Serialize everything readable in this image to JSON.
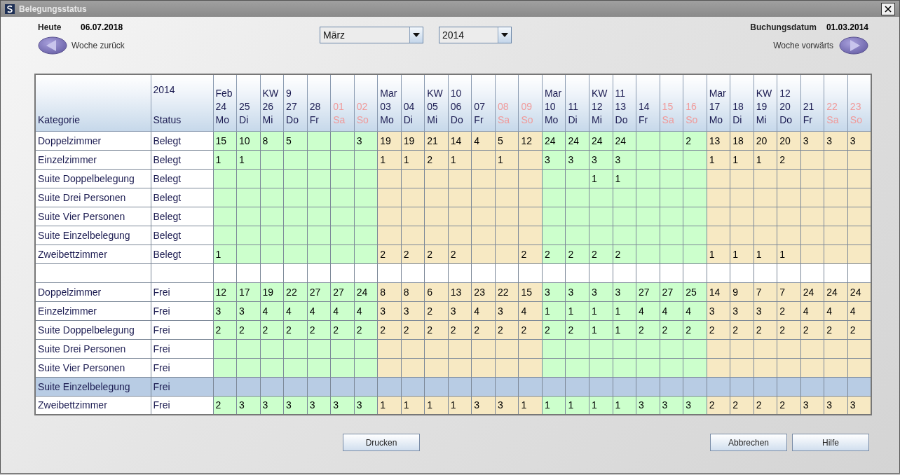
{
  "window": {
    "title": "Belegungsstatus"
  },
  "today": {
    "label": "Heute",
    "value": "06.07.2018"
  },
  "week_back": {
    "label": "Woche zurück"
  },
  "month_select": {
    "value": "März"
  },
  "year_select": {
    "value": "2014"
  },
  "booking_date": {
    "label": "Buchungsdatum",
    "value": "01.03.2014"
  },
  "week_forward": {
    "label": "Woche vorwärts"
  },
  "table": {
    "category_header": "Kategorie",
    "status_header": [
      "2014",
      "Status"
    ],
    "columns": [
      {
        "lines": [
          "Feb",
          "24",
          "Mo"
        ],
        "weekend": false,
        "color": "#ccffcc"
      },
      {
        "lines": [
          "25",
          "Di"
        ],
        "weekend": false,
        "color": "#ccffcc"
      },
      {
        "lines": [
          "KW",
          "26",
          "Mi"
        ],
        "weekend": false,
        "color": "#ccffcc"
      },
      {
        "lines": [
          "9",
          "27",
          "Do"
        ],
        "weekend": false,
        "color": "#ccffcc"
      },
      {
        "lines": [
          "28",
          "Fr"
        ],
        "weekend": false,
        "color": "#ccffcc"
      },
      {
        "lines": [
          "01",
          "Sa"
        ],
        "weekend": true,
        "color": "#ccffcc"
      },
      {
        "lines": [
          "02",
          "So"
        ],
        "weekend": true,
        "color": "#ccffcc"
      },
      {
        "lines": [
          "Mar",
          "03",
          "Mo"
        ],
        "weekend": false,
        "color": "#f7e9c3"
      },
      {
        "lines": [
          "04",
          "Di"
        ],
        "weekend": false,
        "color": "#f7e9c3"
      },
      {
        "lines": [
          "KW",
          "05",
          "Mi"
        ],
        "weekend": false,
        "color": "#f7e9c3"
      },
      {
        "lines": [
          "10",
          "06",
          "Do"
        ],
        "weekend": false,
        "color": "#f7e9c3"
      },
      {
        "lines": [
          "07",
          "Fr"
        ],
        "weekend": false,
        "color": "#f7e9c3"
      },
      {
        "lines": [
          "08",
          "Sa"
        ],
        "weekend": true,
        "color": "#f7e9c3"
      },
      {
        "lines": [
          "09",
          "So"
        ],
        "weekend": true,
        "color": "#f7e9c3"
      },
      {
        "lines": [
          "Mar",
          "10",
          "Mo"
        ],
        "weekend": false,
        "color": "#ccffcc"
      },
      {
        "lines": [
          "11",
          "Di"
        ],
        "weekend": false,
        "color": "#ccffcc"
      },
      {
        "lines": [
          "KW",
          "12",
          "Mi"
        ],
        "weekend": false,
        "color": "#ccffcc"
      },
      {
        "lines": [
          "11",
          "13",
          "Do"
        ],
        "weekend": false,
        "color": "#ccffcc"
      },
      {
        "lines": [
          "14",
          "Fr"
        ],
        "weekend": false,
        "color": "#ccffcc"
      },
      {
        "lines": [
          "15",
          "Sa"
        ],
        "weekend": true,
        "color": "#ccffcc"
      },
      {
        "lines": [
          "16",
          "So"
        ],
        "weekend": true,
        "color": "#ccffcc"
      },
      {
        "lines": [
          "Mar",
          "17",
          "Mo"
        ],
        "weekend": false,
        "color": "#f7e9c3"
      },
      {
        "lines": [
          "18",
          "Di"
        ],
        "weekend": false,
        "color": "#f7e9c3"
      },
      {
        "lines": [
          "KW",
          "19",
          "Mi"
        ],
        "weekend": false,
        "color": "#f7e9c3"
      },
      {
        "lines": [
          "12",
          "20",
          "Do"
        ],
        "weekend": false,
        "color": "#f7e9c3"
      },
      {
        "lines": [
          "21",
          "Fr"
        ],
        "weekend": false,
        "color": "#f7e9c3"
      },
      {
        "lines": [
          "22",
          "Sa"
        ],
        "weekend": true,
        "color": "#f7e9c3"
      },
      {
        "lines": [
          "23",
          "So"
        ],
        "weekend": true,
        "color": "#f7e9c3"
      }
    ],
    "rows": [
      {
        "kind": "data",
        "selected": false,
        "category": "Doppelzimmer",
        "status": "Belegt",
        "cells": [
          {
            "kind": "number",
            "value": "15"
          },
          {
            "kind": "number",
            "value": "10"
          },
          {
            "kind": "number",
            "value": "8"
          },
          {
            "kind": "number",
            "value": "5"
          },
          {
            "kind": "blank"
          },
          {
            "kind": "blank"
          },
          {
            "kind": "number",
            "value": "3"
          },
          {
            "kind": "number",
            "value": "19"
          },
          {
            "kind": "number",
            "value": "19"
          },
          {
            "kind": "number",
            "value": "21"
          },
          {
            "kind": "number",
            "value": "14"
          },
          {
            "kind": "number",
            "value": "4"
          },
          {
            "kind": "number",
            "value": "5"
          },
          {
            "kind": "number",
            "value": "12"
          },
          {
            "kind": "number",
            "value": "24"
          },
          {
            "kind": "number",
            "value": "24"
          },
          {
            "kind": "number",
            "value": "24"
          },
          {
            "kind": "number",
            "value": "24"
          },
          {
            "kind": "blank"
          },
          {
            "kind": "blank"
          },
          {
            "kind": "number",
            "value": "2"
          },
          {
            "kind": "number",
            "value": "13"
          },
          {
            "kind": "number",
            "value": "18"
          },
          {
            "kind": "number",
            "value": "20"
          },
          {
            "kind": "number",
            "value": "20"
          },
          {
            "kind": "number",
            "value": "3"
          },
          {
            "kind": "number",
            "value": "3"
          },
          {
            "kind": "number",
            "value": "3"
          }
        ]
      },
      {
        "kind": "data",
        "selected": false,
        "category": "Einzelzimmer",
        "status": "Belegt",
        "cells": [
          {
            "kind": "number",
            "value": "1"
          },
          {
            "kind": "number",
            "value": "1"
          },
          {
            "kind": "blank"
          },
          {
            "kind": "blank"
          },
          {
            "kind": "blank"
          },
          {
            "kind": "blank"
          },
          {
            "kind": "blank"
          },
          {
            "kind": "number",
            "value": "1"
          },
          {
            "kind": "number",
            "value": "1"
          },
          {
            "kind": "number",
            "value": "2"
          },
          {
            "kind": "number",
            "value": "1"
          },
          {
            "kind": "blank"
          },
          {
            "kind": "number",
            "value": "1"
          },
          {
            "kind": "blank"
          },
          {
            "kind": "number",
            "value": "3"
          },
          {
            "kind": "number",
            "value": "3"
          },
          {
            "kind": "number",
            "value": "3"
          },
          {
            "kind": "number",
            "value": "3"
          },
          {
            "kind": "blank"
          },
          {
            "kind": "blank"
          },
          {
            "kind": "blank"
          },
          {
            "kind": "number",
            "value": "1"
          },
          {
            "kind": "number",
            "value": "1"
          },
          {
            "kind": "number",
            "value": "1"
          },
          {
            "kind": "number",
            "value": "2"
          },
          {
            "kind": "blank"
          },
          {
            "kind": "blank"
          },
          {
            "kind": "blank"
          }
        ]
      },
      {
        "kind": "data",
        "selected": false,
        "category": "Suite Doppelbelegung",
        "status": "Belegt",
        "cells": [
          {
            "kind": "blank"
          },
          {
            "kind": "blank"
          },
          {
            "kind": "blank"
          },
          {
            "kind": "blank"
          },
          {
            "kind": "blank"
          },
          {
            "kind": "blank"
          },
          {
            "kind": "blank"
          },
          {
            "kind": "blank"
          },
          {
            "kind": "blank"
          },
          {
            "kind": "blank"
          },
          {
            "kind": "blank"
          },
          {
            "kind": "blank"
          },
          {
            "kind": "blank"
          },
          {
            "kind": "blank"
          },
          {
            "kind": "blank"
          },
          {
            "kind": "blank"
          },
          {
            "kind": "number",
            "value": "1"
          },
          {
            "kind": "number",
            "value": "1"
          },
          {
            "kind": "blank"
          },
          {
            "kind": "blank"
          },
          {
            "kind": "blank"
          },
          {
            "kind": "blank"
          },
          {
            "kind": "blank"
          },
          {
            "kind": "blank"
          },
          {
            "kind": "blank"
          },
          {
            "kind": "blank"
          },
          {
            "kind": "blank"
          },
          {
            "kind": "blank"
          }
        ]
      },
      {
        "kind": "data",
        "selected": false,
        "category": "Suite Drei Personen",
        "status": "Belegt",
        "cells": [
          {
            "kind": "blank"
          },
          {
            "kind": "blank"
          },
          {
            "kind": "blank"
          },
          {
            "kind": "blank"
          },
          {
            "kind": "blank"
          },
          {
            "kind": "blank"
          },
          {
            "kind": "blank"
          },
          {
            "kind": "blank"
          },
          {
            "kind": "blank"
          },
          {
            "kind": "blank"
          },
          {
            "kind": "blank"
          },
          {
            "kind": "blank"
          },
          {
            "kind": "blank"
          },
          {
            "kind": "blank"
          },
          {
            "kind": "blank"
          },
          {
            "kind": "blank"
          },
          {
            "kind": "blank"
          },
          {
            "kind": "blank"
          },
          {
            "kind": "blank"
          },
          {
            "kind": "blank"
          },
          {
            "kind": "blank"
          },
          {
            "kind": "blank"
          },
          {
            "kind": "blank"
          },
          {
            "kind": "blank"
          },
          {
            "kind": "blank"
          },
          {
            "kind": "blank"
          },
          {
            "kind": "blank"
          },
          {
            "kind": "blank"
          }
        ]
      },
      {
        "kind": "data",
        "selected": false,
        "category": "Suite Vier Personen",
        "status": "Belegt",
        "cells": [
          {
            "kind": "blank"
          },
          {
            "kind": "blank"
          },
          {
            "kind": "blank"
          },
          {
            "kind": "blank"
          },
          {
            "kind": "blank"
          },
          {
            "kind": "blank"
          },
          {
            "kind": "blank"
          },
          {
            "kind": "blank"
          },
          {
            "kind": "blank"
          },
          {
            "kind": "blank"
          },
          {
            "kind": "blank"
          },
          {
            "kind": "blank"
          },
          {
            "kind": "blank"
          },
          {
            "kind": "blank"
          },
          {
            "kind": "blank"
          },
          {
            "kind": "blank"
          },
          {
            "kind": "blank"
          },
          {
            "kind": "blank"
          },
          {
            "kind": "blank"
          },
          {
            "kind": "blank"
          },
          {
            "kind": "blank"
          },
          {
            "kind": "blank"
          },
          {
            "kind": "blank"
          },
          {
            "kind": "blank"
          },
          {
            "kind": "blank"
          },
          {
            "kind": "blank"
          },
          {
            "kind": "blank"
          },
          {
            "kind": "blank"
          }
        ]
      },
      {
        "kind": "data",
        "selected": false,
        "category": "Suite Einzelbelegung",
        "status": "Belegt",
        "cells": [
          {
            "kind": "blank"
          },
          {
            "kind": "blank"
          },
          {
            "kind": "blank"
          },
          {
            "kind": "blank"
          },
          {
            "kind": "blank"
          },
          {
            "kind": "blank"
          },
          {
            "kind": "blank"
          },
          {
            "kind": "blank"
          },
          {
            "kind": "blank"
          },
          {
            "kind": "blank"
          },
          {
            "kind": "blank"
          },
          {
            "kind": "blank"
          },
          {
            "kind": "blank"
          },
          {
            "kind": "blank"
          },
          {
            "kind": "blank"
          },
          {
            "kind": "blank"
          },
          {
            "kind": "blank"
          },
          {
            "kind": "blank"
          },
          {
            "kind": "blank"
          },
          {
            "kind": "blank"
          },
          {
            "kind": "blank"
          },
          {
            "kind": "blank"
          },
          {
            "kind": "blank"
          },
          {
            "kind": "blank"
          },
          {
            "kind": "blank"
          },
          {
            "kind": "blank"
          },
          {
            "kind": "blank"
          },
          {
            "kind": "blank"
          }
        ]
      },
      {
        "kind": "data",
        "selected": false,
        "category": "Zweibettzimmer",
        "status": "Belegt",
        "cells": [
          {
            "kind": "number",
            "value": "1"
          },
          {
            "kind": "blank"
          },
          {
            "kind": "blank"
          },
          {
            "kind": "blank"
          },
          {
            "kind": "blank"
          },
          {
            "kind": "blank"
          },
          {
            "kind": "blank"
          },
          {
            "kind": "number",
            "value": "2"
          },
          {
            "kind": "number",
            "value": "2"
          },
          {
            "kind": "number",
            "value": "2"
          },
          {
            "kind": "number",
            "value": "2"
          },
          {
            "kind": "blank"
          },
          {
            "kind": "blank"
          },
          {
            "kind": "number",
            "value": "2"
          },
          {
            "kind": "number",
            "value": "2"
          },
          {
            "kind": "number",
            "value": "2"
          },
          {
            "kind": "number",
            "value": "2"
          },
          {
            "kind": "number",
            "value": "2"
          },
          {
            "kind": "blank"
          },
          {
            "kind": "blank"
          },
          {
            "kind": "blank"
          },
          {
            "kind": "number",
            "value": "1"
          },
          {
            "kind": "number",
            "value": "1"
          },
          {
            "kind": "number",
            "value": "1"
          },
          {
            "kind": "number",
            "value": "1"
          },
          {
            "kind": "blank"
          },
          {
            "kind": "blank"
          },
          {
            "kind": "blank"
          }
        ]
      },
      {
        "kind": "spacer",
        "selected": false
      },
      {
        "kind": "data",
        "selected": false,
        "category": "Doppelzimmer",
        "status": "Frei",
        "cells": [
          {
            "kind": "number",
            "value": "12"
          },
          {
            "kind": "number",
            "value": "17"
          },
          {
            "kind": "number",
            "value": "19"
          },
          {
            "kind": "number",
            "value": "22"
          },
          {
            "kind": "number",
            "value": "27"
          },
          {
            "kind": "number",
            "value": "27"
          },
          {
            "kind": "number",
            "value": "24"
          },
          {
            "kind": "number",
            "value": "8"
          },
          {
            "kind": "number",
            "value": "8"
          },
          {
            "kind": "number",
            "value": "6"
          },
          {
            "kind": "number",
            "value": "13"
          },
          {
            "kind": "number",
            "value": "23"
          },
          {
            "kind": "number",
            "value": "22"
          },
          {
            "kind": "number",
            "value": "15"
          },
          {
            "kind": "number",
            "value": "3"
          },
          {
            "kind": "number",
            "value": "3"
          },
          {
            "kind": "number",
            "value": "3"
          },
          {
            "kind": "number",
            "value": "3"
          },
          {
            "kind": "number",
            "value": "27"
          },
          {
            "kind": "number",
            "value": "27"
          },
          {
            "kind": "number",
            "value": "25"
          },
          {
            "kind": "number",
            "value": "14"
          },
          {
            "kind": "number",
            "value": "9"
          },
          {
            "kind": "number",
            "value": "7"
          },
          {
            "kind": "number",
            "value": "7"
          },
          {
            "kind": "number",
            "value": "24"
          },
          {
            "kind": "number",
            "value": "24"
          },
          {
            "kind": "number",
            "value": "24"
          }
        ]
      },
      {
        "kind": "data",
        "selected": false,
        "category": "Einzelzimmer",
        "status": "Frei",
        "cells": [
          {
            "kind": "number",
            "value": "3"
          },
          {
            "kind": "number",
            "value": "3"
          },
          {
            "kind": "number",
            "value": "4"
          },
          {
            "kind": "number",
            "value": "4"
          },
          {
            "kind": "number",
            "value": "4"
          },
          {
            "kind": "number",
            "value": "4"
          },
          {
            "kind": "number",
            "value": "4"
          },
          {
            "kind": "number",
            "value": "3"
          },
          {
            "kind": "number",
            "value": "3"
          },
          {
            "kind": "number",
            "value": "2"
          },
          {
            "kind": "number",
            "value": "3"
          },
          {
            "kind": "number",
            "value": "4"
          },
          {
            "kind": "number",
            "value": "3"
          },
          {
            "kind": "number",
            "value": "4"
          },
          {
            "kind": "number",
            "value": "1"
          },
          {
            "kind": "number",
            "value": "1"
          },
          {
            "kind": "number",
            "value": "1"
          },
          {
            "kind": "number",
            "value": "1"
          },
          {
            "kind": "number",
            "value": "4"
          },
          {
            "kind": "number",
            "value": "4"
          },
          {
            "kind": "number",
            "value": "4"
          },
          {
            "kind": "number",
            "value": "3"
          },
          {
            "kind": "number",
            "value": "3"
          },
          {
            "kind": "number",
            "value": "3"
          },
          {
            "kind": "number",
            "value": "2"
          },
          {
            "kind": "number",
            "value": "4"
          },
          {
            "kind": "number",
            "value": "4"
          },
          {
            "kind": "number",
            "value": "4"
          }
        ]
      },
      {
        "kind": "data",
        "selected": false,
        "category": "Suite Doppelbelegung",
        "status": "Frei",
        "cells": [
          {
            "kind": "number",
            "value": "2"
          },
          {
            "kind": "number",
            "value": "2"
          },
          {
            "kind": "number",
            "value": "2"
          },
          {
            "kind": "number",
            "value": "2"
          },
          {
            "kind": "number",
            "value": "2"
          },
          {
            "kind": "number",
            "value": "2"
          },
          {
            "kind": "number",
            "value": "2"
          },
          {
            "kind": "number",
            "value": "2"
          },
          {
            "kind": "number",
            "value": "2"
          },
          {
            "kind": "number",
            "value": "2"
          },
          {
            "kind": "number",
            "value": "2"
          },
          {
            "kind": "number",
            "value": "2"
          },
          {
            "kind": "number",
            "value": "2"
          },
          {
            "kind": "number",
            "value": "2"
          },
          {
            "kind": "number",
            "value": "2"
          },
          {
            "kind": "number",
            "value": "2"
          },
          {
            "kind": "number",
            "value": "1"
          },
          {
            "kind": "number",
            "value": "1"
          },
          {
            "kind": "number",
            "value": "2"
          },
          {
            "kind": "number",
            "value": "2"
          },
          {
            "kind": "number",
            "value": "2"
          },
          {
            "kind": "number",
            "value": "2"
          },
          {
            "kind": "number",
            "value": "2"
          },
          {
            "kind": "number",
            "value": "2"
          },
          {
            "kind": "number",
            "value": "2"
          },
          {
            "kind": "number",
            "value": "2"
          },
          {
            "kind": "number",
            "value": "2"
          },
          {
            "kind": "number",
            "value": "2"
          }
        ]
      },
      {
        "kind": "data",
        "selected": false,
        "category": "Suite Drei Personen",
        "status": "Frei",
        "cells": [
          {
            "kind": "blank"
          },
          {
            "kind": "blank"
          },
          {
            "kind": "blank"
          },
          {
            "kind": "blank"
          },
          {
            "kind": "blank"
          },
          {
            "kind": "blank"
          },
          {
            "kind": "blank"
          },
          {
            "kind": "blank"
          },
          {
            "kind": "blank"
          },
          {
            "kind": "blank"
          },
          {
            "kind": "blank"
          },
          {
            "kind": "blank"
          },
          {
            "kind": "blank"
          },
          {
            "kind": "blank"
          },
          {
            "kind": "blank"
          },
          {
            "kind": "blank"
          },
          {
            "kind": "blank"
          },
          {
            "kind": "blank"
          },
          {
            "kind": "blank"
          },
          {
            "kind": "blank"
          },
          {
            "kind": "blank"
          },
          {
            "kind": "blank"
          },
          {
            "kind": "blank"
          },
          {
            "kind": "blank"
          },
          {
            "kind": "blank"
          },
          {
            "kind": "blank"
          },
          {
            "kind": "blank"
          },
          {
            "kind": "blank"
          }
        ]
      },
      {
        "kind": "data",
        "selected": false,
        "category": "Suite Vier Personen",
        "status": "Frei",
        "cells": [
          {
            "kind": "blank"
          },
          {
            "kind": "blank"
          },
          {
            "kind": "blank"
          },
          {
            "kind": "blank"
          },
          {
            "kind": "blank"
          },
          {
            "kind": "blank"
          },
          {
            "kind": "blank"
          },
          {
            "kind": "blank"
          },
          {
            "kind": "blank"
          },
          {
            "kind": "blank"
          },
          {
            "kind": "blank"
          },
          {
            "kind": "blank"
          },
          {
            "kind": "blank"
          },
          {
            "kind": "blank"
          },
          {
            "kind": "blank"
          },
          {
            "kind": "blank"
          },
          {
            "kind": "blank"
          },
          {
            "kind": "blank"
          },
          {
            "kind": "blank"
          },
          {
            "kind": "blank"
          },
          {
            "kind": "blank"
          },
          {
            "kind": "blank"
          },
          {
            "kind": "blank"
          },
          {
            "kind": "blank"
          },
          {
            "kind": "blank"
          },
          {
            "kind": "blank"
          },
          {
            "kind": "blank"
          },
          {
            "kind": "blank"
          }
        ]
      },
      {
        "kind": "data",
        "selected": true,
        "category": "Suite Einzelbelegung",
        "status": "Frei",
        "cells": [
          {
            "kind": "blank"
          },
          {
            "kind": "blank"
          },
          {
            "kind": "blank"
          },
          {
            "kind": "blank"
          },
          {
            "kind": "blank"
          },
          {
            "kind": "blank"
          },
          {
            "kind": "blank"
          },
          {
            "kind": "blank"
          },
          {
            "kind": "blank"
          },
          {
            "kind": "blank"
          },
          {
            "kind": "blank"
          },
          {
            "kind": "blank"
          },
          {
            "kind": "blank"
          },
          {
            "kind": "blank"
          },
          {
            "kind": "blank"
          },
          {
            "kind": "blank"
          },
          {
            "kind": "blank"
          },
          {
            "kind": "blank"
          },
          {
            "kind": "blank"
          },
          {
            "kind": "blank"
          },
          {
            "kind": "blank"
          },
          {
            "kind": "blank"
          },
          {
            "kind": "blank"
          },
          {
            "kind": "blank"
          },
          {
            "kind": "blank"
          },
          {
            "kind": "blank"
          },
          {
            "kind": "blank"
          },
          {
            "kind": "blank"
          }
        ]
      },
      {
        "kind": "data",
        "selected": false,
        "category": "Zweibettzimmer",
        "status": "Frei",
        "cells": [
          {
            "kind": "number",
            "value": "2"
          },
          {
            "kind": "number",
            "value": "3"
          },
          {
            "kind": "number",
            "value": "3"
          },
          {
            "kind": "number",
            "value": "3"
          },
          {
            "kind": "number",
            "value": "3"
          },
          {
            "kind": "number",
            "value": "3"
          },
          {
            "kind": "number",
            "value": "3"
          },
          {
            "kind": "number",
            "value": "1"
          },
          {
            "kind": "number",
            "value": "1"
          },
          {
            "kind": "number",
            "value": "1"
          },
          {
            "kind": "number",
            "value": "1"
          },
          {
            "kind": "number",
            "value": "3"
          },
          {
            "kind": "number",
            "value": "3"
          },
          {
            "kind": "number",
            "value": "1"
          },
          {
            "kind": "number",
            "value": "1"
          },
          {
            "kind": "number",
            "value": "1"
          },
          {
            "kind": "number",
            "value": "1"
          },
          {
            "kind": "number",
            "value": "1"
          },
          {
            "kind": "number",
            "value": "3"
          },
          {
            "kind": "number",
            "value": "3"
          },
          {
            "kind": "number",
            "value": "3"
          },
          {
            "kind": "number",
            "value": "2"
          },
          {
            "kind": "number",
            "value": "2"
          },
          {
            "kind": "number",
            "value": "2"
          },
          {
            "kind": "number",
            "value": "2"
          },
          {
            "kind": "number",
            "value": "3"
          },
          {
            "kind": "number",
            "value": "3"
          },
          {
            "kind": "number",
            "value": "3"
          }
        ]
      }
    ]
  },
  "print_button": {
    "label": "Drucken"
  },
  "dialog_buttons": [
    {
      "label": "Abbrechen"
    },
    {
      "label": "Hilfe"
    }
  ]
}
